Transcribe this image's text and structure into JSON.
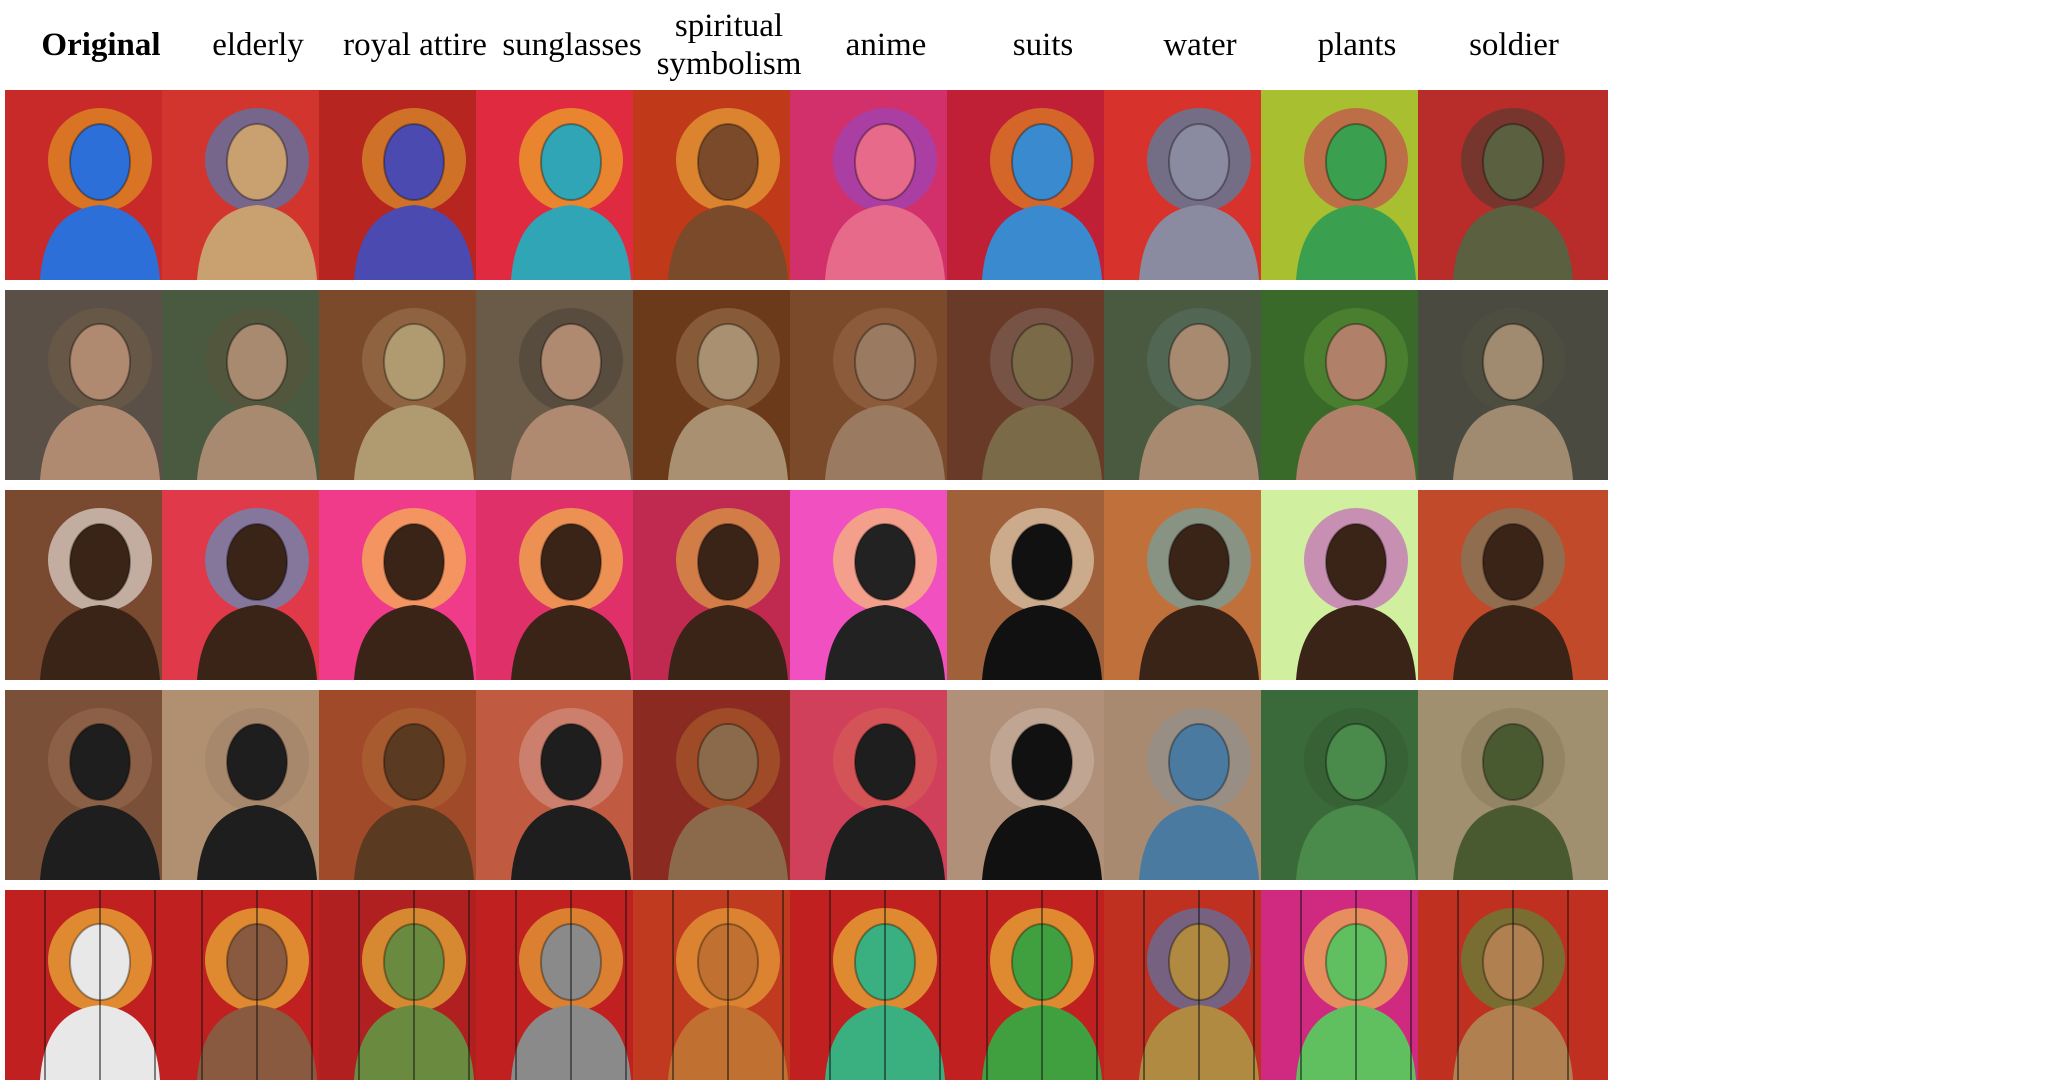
{
  "columns": [
    "Original",
    "elderly",
    "royal attire",
    "sunglasses",
    "spiritual symbolism",
    "anime",
    "suits",
    "water",
    "plants",
    "soldier"
  ],
  "rows": [
    {
      "bg": "#d8262a",
      "accent": "#2a5bd7",
      "figure": "#3a7bd5",
      "tiles": [
        {
          "bg": "#c82a2a",
          "fig": "#2c6fd9",
          "accent": "#e8b020"
        },
        {
          "bg": "#d1352d",
          "fig": "#c9a070",
          "accent": "#2c8ed9"
        },
        {
          "bg": "#b62520",
          "fig": "#4a4ab0",
          "accent": "#e6b030"
        },
        {
          "bg": "#e02a40",
          "fig": "#2fa5b5",
          "accent": "#f2d020"
        },
        {
          "bg": "#c03a1a",
          "fig": "#7a4a2a",
          "accent": "#f0c040"
        },
        {
          "bg": "#d2306a",
          "fig": "#e86a8a",
          "accent": "#8a4ad0"
        },
        {
          "bg": "#c02035",
          "fig": "#3a8ad0",
          "accent": "#e6a020"
        },
        {
          "bg": "#d8322c",
          "fig": "#8a8aa0",
          "accent": "#20a0d0"
        },
        {
          "bg": "#a8c030",
          "fig": "#3aa050",
          "accent": "#d02a5a"
        },
        {
          "bg": "#b82c2a",
          "fig": "#5a6040",
          "accent": "#404030"
        }
      ]
    },
    {
      "bg": "#6a5a48",
      "accent": "#d0b090",
      "figure": "#8a6a50",
      "tiles": [
        {
          "bg": "#5a5048",
          "fig": "#b08a70",
          "accent": "#8a6a40"
        },
        {
          "bg": "#4a5a40",
          "fig": "#a88a70",
          "accent": "#6a4a30"
        },
        {
          "bg": "#7a4a2a",
          "fig": "#b09a70",
          "accent": "#d0b080"
        },
        {
          "bg": "#6a5a48",
          "fig": "#b08a70",
          "accent": "#222222"
        },
        {
          "bg": "#6a3a1a",
          "fig": "#a89070",
          "accent": "#e0c090"
        },
        {
          "bg": "#7a4a2a",
          "fig": "#9a7a60",
          "accent": "#c09070"
        },
        {
          "bg": "#6a3a28",
          "fig": "#7a6a48",
          "accent": "#a0a0a0"
        },
        {
          "bg": "#4a5a40",
          "fig": "#a88a70",
          "accent": "#6a8a90"
        },
        {
          "bg": "#3a6a2a",
          "fig": "#b08068",
          "accent": "#7ac040"
        },
        {
          "bg": "#4a4a40",
          "fig": "#a08a70",
          "accent": "#5a5a40"
        }
      ]
    },
    {
      "bg": "#8a5a3a",
      "accent": "#f0f0f0",
      "figure": "#c090d0",
      "tiles": [
        {
          "bg": "#7a4a30",
          "fig": "#3a2418",
          "accent": "#ffffff"
        },
        {
          "bg": "#e03a4a",
          "fig": "#3a2418",
          "accent": "#3aa8e0"
        },
        {
          "bg": "#f03a8a",
          "fig": "#3a2418",
          "accent": "#f8e040"
        },
        {
          "bg": "#e0306a",
          "fig": "#3a2418",
          "accent": "#f8e040"
        },
        {
          "bg": "#c02a50",
          "fig": "#3a2418",
          "accent": "#e0c040"
        },
        {
          "bg": "#f050c0",
          "fig": "#222222",
          "accent": "#f8e060"
        },
        {
          "bg": "#a0603a",
          "fig": "#111111",
          "accent": "#f0e8d0"
        },
        {
          "bg": "#c0703a",
          "fig": "#3a2418",
          "accent": "#5ab0c0"
        },
        {
          "bg": "#d0f0a0",
          "fig": "#3a2418",
          "accent": "#c040c0"
        },
        {
          "bg": "#c04a2a",
          "fig": "#3a2418",
          "accent": "#6a8a70"
        }
      ]
    },
    {
      "bg": "#8a6040",
      "accent": "#2a2a2a",
      "figure": "#222222",
      "tiles": [
        {
          "bg": "#7a5038",
          "fig": "#1e1e1e",
          "accent": "#c09070"
        },
        {
          "bg": "#b09070",
          "fig": "#1e1e1e",
          "accent": "#8a7060"
        },
        {
          "bg": "#a04a2a",
          "fig": "#5a3a20",
          "accent": "#c09040"
        },
        {
          "bg": "#c05a40",
          "fig": "#1e1e1e",
          "accent": "#f0f0f0"
        },
        {
          "bg": "#8a2a20",
          "fig": "#8a6a4a",
          "accent": "#e0b040"
        },
        {
          "bg": "#d0405a",
          "fig": "#1e1e1e",
          "accent": "#e08a50"
        },
        {
          "bg": "#b09078",
          "fig": "#111111",
          "accent": "#f0e8e0"
        },
        {
          "bg": "#a88a70",
          "fig": "#4a7aa0",
          "accent": "#6a9ac0"
        },
        {
          "bg": "#3a6a3a",
          "fig": "#4a8a4a",
          "accent": "#2a4a2a"
        },
        {
          "bg": "#a09070",
          "fig": "#4a5a30",
          "accent": "#6a6040"
        }
      ]
    },
    {
      "bg": "#c02020",
      "accent": "#f8e040",
      "figure": "#f0f0f0",
      "tiles": [
        {
          "bg": "#c02020",
          "fig": "#e8e8e8",
          "accent": "#f8e040"
        },
        {
          "bg": "#c02020",
          "fig": "#8a5a40",
          "accent": "#f8e040"
        },
        {
          "bg": "#b02020",
          "fig": "#6a8a40",
          "accent": "#f8e040"
        },
        {
          "bg": "#c02020",
          "fig": "#8a8a8a",
          "accent": "#f0d040"
        },
        {
          "bg": "#c03a20",
          "fig": "#c07030",
          "accent": "#f0c040"
        },
        {
          "bg": "#c02020",
          "fig": "#3ab080",
          "accent": "#f8e040"
        },
        {
          "bg": "#c02020",
          "fig": "#40a040",
          "accent": "#f8e040"
        },
        {
          "bg": "#c03020",
          "fig": "#b08a40",
          "accent": "#3a8ad0"
        },
        {
          "bg": "#d02a80",
          "fig": "#60c060",
          "accent": "#f8e040"
        },
        {
          "bg": "#c03020",
          "fig": "#b08050",
          "accent": "#40a040"
        }
      ]
    }
  ]
}
